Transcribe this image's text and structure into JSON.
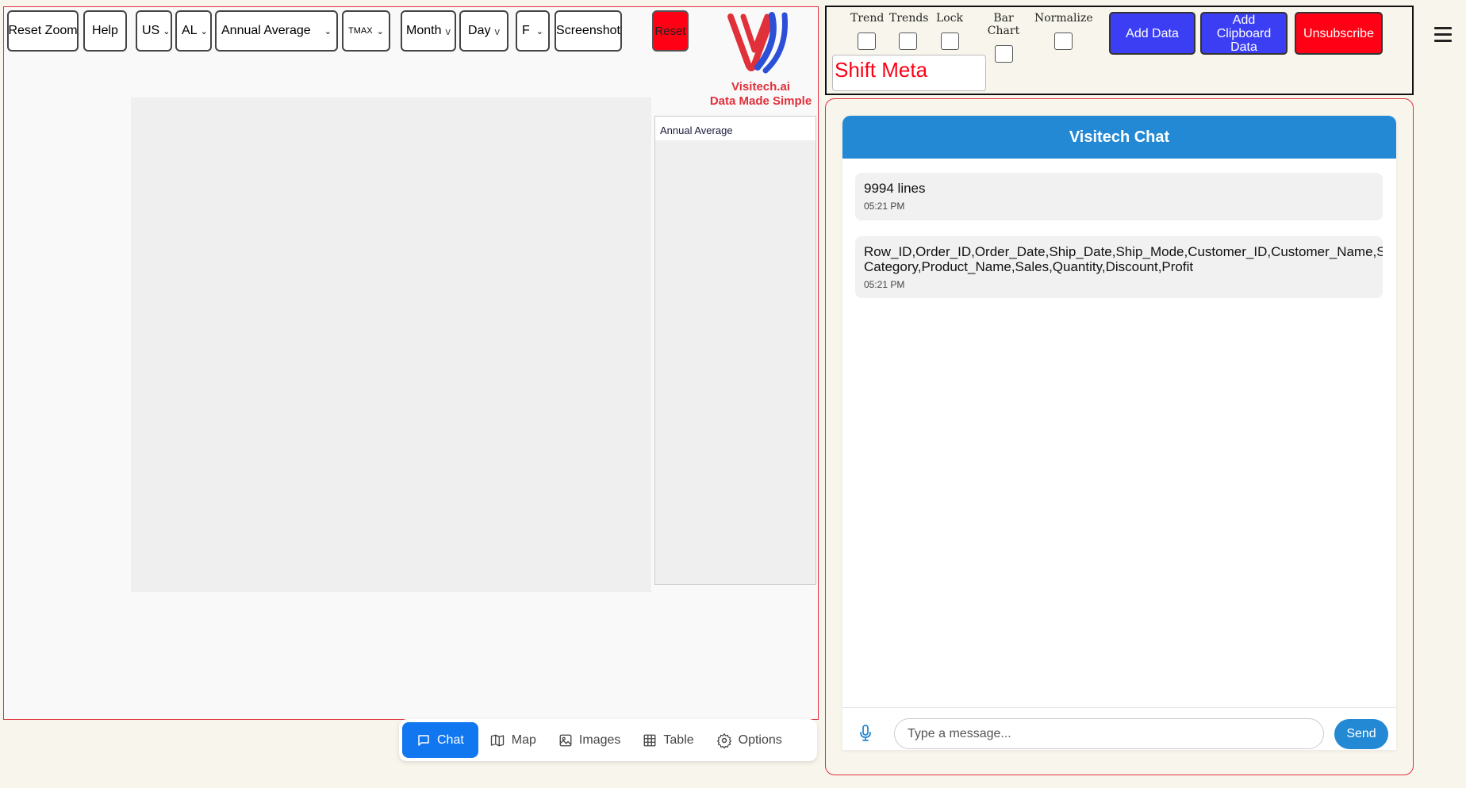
{
  "toolbar": {
    "reset_zoom": "Reset Zoom",
    "help": "Help",
    "country": "US",
    "state": "AL",
    "metric": "Annual Average",
    "variable": "TMAX",
    "month": "Month",
    "day": "Day",
    "unit": "F",
    "screenshot": "Screenshot",
    "reset": "Reset"
  },
  "logo": {
    "name": "Visitech.ai",
    "tagline": "Data Made Simple",
    "colors": {
      "red": "#e0303a",
      "blue": "#2c4fd8"
    }
  },
  "legend": {
    "items": [
      "Annual Average"
    ]
  },
  "bottom_nav": {
    "items": [
      {
        "label": "Chat",
        "icon": "chat-icon",
        "active": true
      },
      {
        "label": "Map",
        "icon": "map-icon",
        "active": false
      },
      {
        "label": "Images",
        "icon": "image-icon",
        "active": false
      },
      {
        "label": "Table",
        "icon": "table-icon",
        "active": false
      },
      {
        "label": "Options",
        "icon": "gear-icon",
        "active": false
      }
    ]
  },
  "controls": {
    "checkboxes": [
      {
        "label": "Trend",
        "checked": false
      },
      {
        "label": "Trends",
        "checked": false
      },
      {
        "label": "Lock",
        "checked": false
      },
      {
        "label": "Bar Chart",
        "checked": false
      },
      {
        "label": "Normalize",
        "checked": false
      }
    ],
    "add_data": "Add Data",
    "add_clipboard_data": "Add Clipboard Data",
    "unsubscribe": "Unsubscribe",
    "shift_meta": "Shift Meta"
  },
  "chat": {
    "title": "Visitech Chat",
    "messages": [
      {
        "text": "9994 lines",
        "time": "05:21 PM"
      },
      {
        "text_line1": "Row_ID,Order_ID,Order_Date,Ship_Date,Ship_Mode,Customer_ID,Customer_Name,Segment,Country,City,State,Postal_Code,Region,Product_ID,Category,Sub-",
        "text_line2": "Category,Product_Name,Sales,Quantity,Discount,Profit",
        "time": "05:21 PM"
      }
    ],
    "input_placeholder": "Type a message...",
    "send": "Send"
  },
  "colors": {
    "accent_blue": "#2389d4",
    "nav_active": "#1177f0",
    "action_blue": "#3b3ef2",
    "danger_red": "#ff0014"
  }
}
